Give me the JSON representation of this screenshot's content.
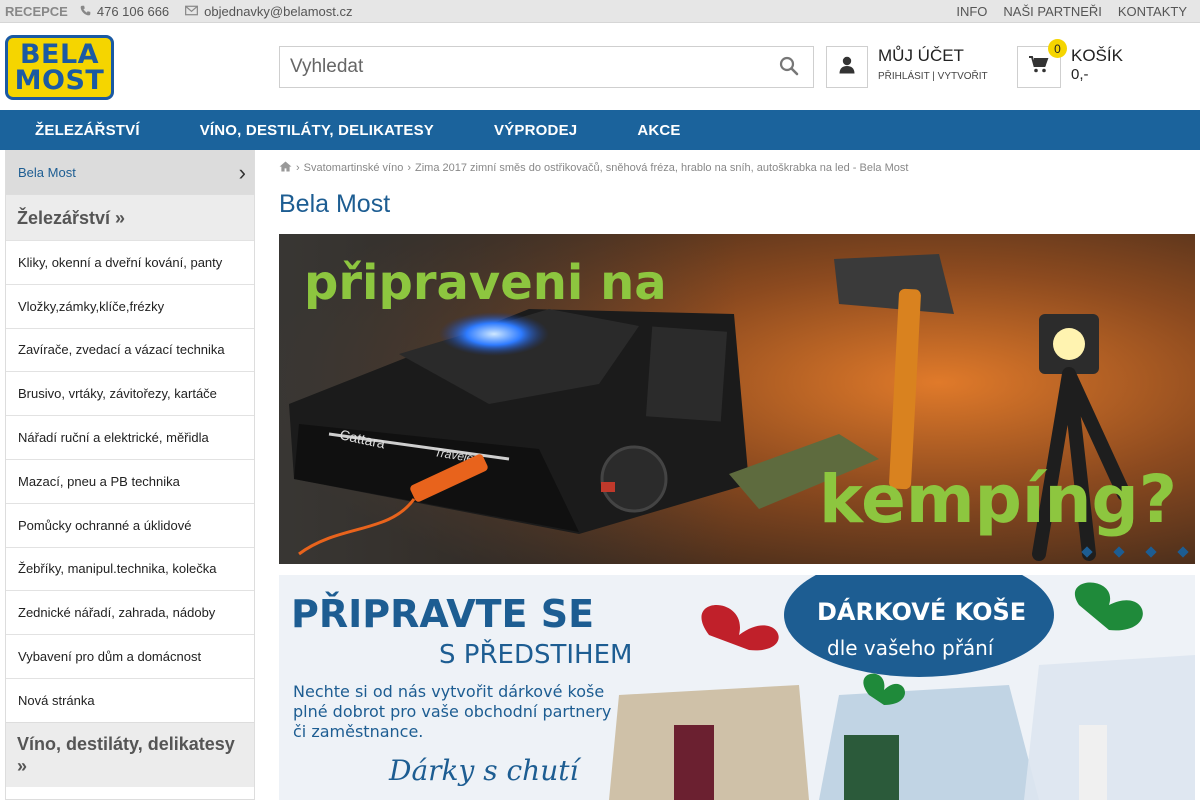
{
  "topbar": {
    "recepce": "RECEPCE",
    "phone": "476 106 666",
    "email": "objednavky@belamost.cz",
    "links": [
      "INFO",
      "NAŠI PARTNEŘI",
      "KONTAKTY"
    ]
  },
  "header": {
    "logo_line1": "BELA",
    "logo_line2": "MOST",
    "search_placeholder": "Vyhledat",
    "account_title": "MŮJ ÚČET",
    "account_sub": "PŘIHLÁSIT | VYTVOŘIT",
    "cart_count": "0",
    "cart_title": "KOŠÍK",
    "cart_price": "0,-"
  },
  "nav": [
    "ŽELEZÁŘSTVÍ",
    "VÍNO, DESTILÁTY, DELIKATESY",
    "VÝPRODEJ",
    "AKCE"
  ],
  "sidebar": {
    "top": "Bela Most",
    "cat1": "Železářství »",
    "items": [
      "Kliky, okenní a dveřní kování, panty",
      "Vložky,zámky,klíče,frézky",
      "Zavírače, zvedací a vázací technika",
      "Brusivo, vrtáky, závitořezy, kartáče",
      "Nářadí ruční a elektrické, měřidla",
      "Mazací, pneu a PB technika",
      "Pomůcky ochranné a úklidové",
      "Žebříky, manipul.technika, kolečka",
      "Zednické nářadí, zahrada, nádoby",
      "Vybavení pro dům a domácnost",
      "Nová stránka"
    ],
    "cat2": "Víno, destiláty, delikatesy »"
  },
  "breadcrumb": {
    "items": [
      "Svatomartinské víno",
      "Zima 2017 zimní směs do ostřikovačů, sněhová fréza, hrablo na sníh, autoškrabka na led - Bela Most"
    ],
    "separator": "›"
  },
  "page_title": "Bela Most",
  "banner1": {
    "line1": "připraveni na",
    "line2": "kempíng?",
    "stove_brand": "Cattara",
    "stove_model": "Traveler"
  },
  "banner2": {
    "headline": "PŘIPRAVTE SE",
    "subheadline": "S PŘEDSTIHEM",
    "text1": "Nechte si od nás vytvořit dárkové koše",
    "text2": "plné dobrot pro vaše obchodní partnery",
    "text3": "či zaměstnance.",
    "script": "Dárky s chutí",
    "oval_title": "DÁRKOVÉ KOŠE",
    "oval_sub": "dle vašeho přání"
  },
  "colors": {
    "nav_blue": "#1b639c",
    "title_blue": "#1d5d92",
    "logo_yellow": "#f5d500",
    "banner_green": "#8dc63f"
  }
}
